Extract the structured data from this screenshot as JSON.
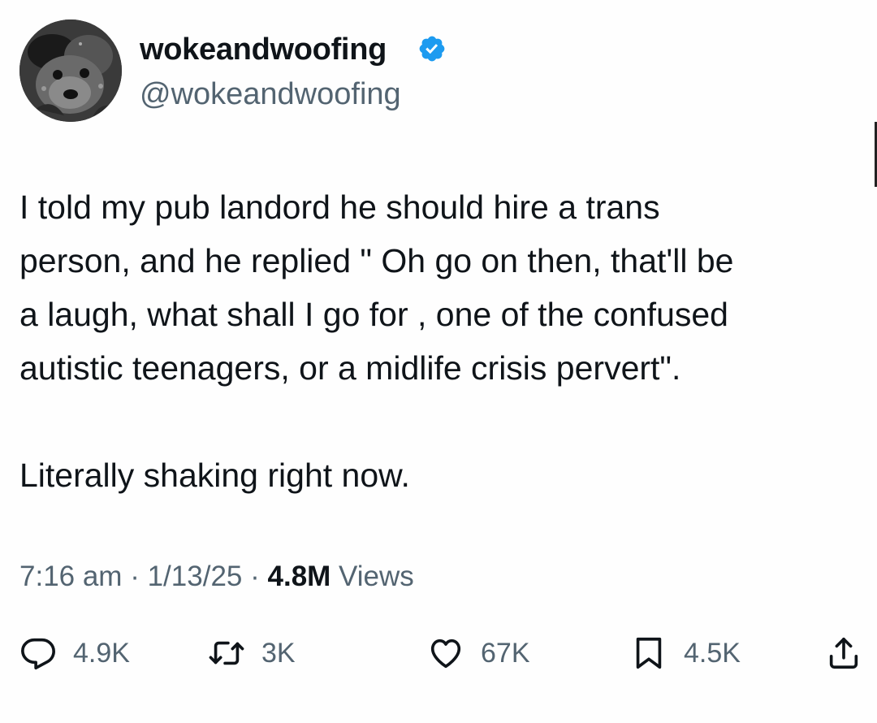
{
  "author": {
    "display_name": "wokeandwoofing",
    "handle": "@wokeandwoofing",
    "verified": true,
    "verified_color": "#1d9bf0",
    "avatar_icon": "dog-avatar"
  },
  "tweet": {
    "lines": [
      "I told my pub landord he should hire a trans",
      "person, and he replied \" Oh go on then, that'll be",
      "a laugh, what shall I go for , one of the confused",
      "autistic teenagers,  or a midlife crisis pervert\"."
    ],
    "second_paragraph": "Literally shaking right now."
  },
  "meta": {
    "time": "7:16 am",
    "separator": "·",
    "date": "1/13/25",
    "views_count": "4.8M",
    "views_label": "Views"
  },
  "actions": {
    "reply": {
      "icon": "reply-icon",
      "count": "4.9K"
    },
    "retweet": {
      "icon": "retweet-icon",
      "count": "3K"
    },
    "like": {
      "icon": "heart-icon",
      "count": "67K"
    },
    "bookmark": {
      "icon": "bookmark-icon",
      "count": "4.5K"
    },
    "share": {
      "icon": "share-icon"
    }
  },
  "colors": {
    "text_primary": "#0f1419",
    "text_secondary": "#536471",
    "background": "#fefefe"
  }
}
